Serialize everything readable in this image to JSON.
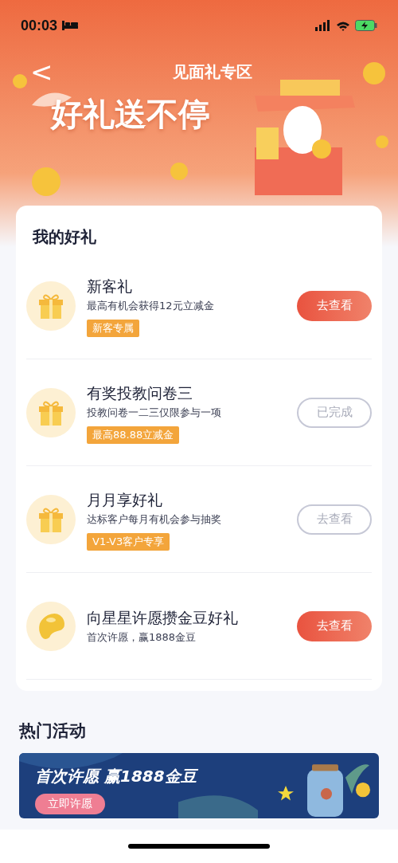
{
  "status_bar": {
    "time": "00:03"
  },
  "nav": {
    "title": "见面礼专区",
    "back": "<"
  },
  "hero": {
    "headline": "好礼送不停"
  },
  "gifts": {
    "title": "我的好礼",
    "items": [
      {
        "kind": "gift",
        "name": "新客礼",
        "desc": "最高有机会获得12元立减金",
        "tag": "新客专属",
        "button": "去查看",
        "disabled": false
      },
      {
        "kind": "gift",
        "name": "有奖投教问卷三",
        "desc": "投教问卷一二三仅限参与一项",
        "tag": "最高88.88立减金",
        "button": "已完成",
        "disabled": true
      },
      {
        "kind": "gift",
        "name": "月月享好礼",
        "desc": "达标客户每月有机会参与抽奖",
        "tag": "V1-V3客户专享",
        "button": "去查看",
        "disabled": true
      },
      {
        "kind": "bean",
        "name": "向星星许愿攒金豆好礼",
        "desc": "首次许愿，赢1888金豆",
        "button": "去查看",
        "disabled": false
      }
    ]
  },
  "activities": {
    "title": "热门活动",
    "banner": {
      "headline": "首次许愿 赢1888金豆",
      "button": "立即许愿"
    }
  }
}
